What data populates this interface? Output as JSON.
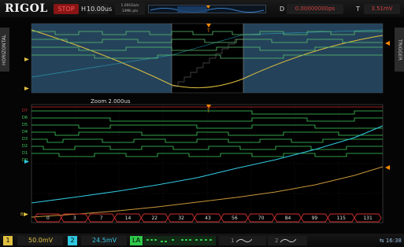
{
  "brand": "RIGOL",
  "run_state": "STOP",
  "timebase": {
    "label": "H",
    "value": "10.00us",
    "sample_rate_line1": "1.00GSa/s",
    "sample_rate_line2": "14Mk pts"
  },
  "delay": {
    "label": "D",
    "value": "0.00000000ps"
  },
  "trigger": {
    "label": "T",
    "value": "3.51mV"
  },
  "side_tabs": {
    "left": "HORIZONTAL",
    "right": "TRIGGER"
  },
  "zoom": {
    "label": "Zoom",
    "value": "2.000us"
  },
  "digital_channels": [
    "D0",
    "D1",
    "D2",
    "D3",
    "D4",
    "D5",
    "D6",
    "D7"
  ],
  "bus_values": [
    "0",
    "3",
    "7",
    "14",
    "22",
    "32",
    "43",
    "56",
    "70",
    "84",
    "99",
    "115",
    "131"
  ],
  "bottom": {
    "ch1": {
      "num": "1",
      "scale": "50.0mV"
    },
    "ch2": {
      "num": "2",
      "scale": "24.5mV"
    },
    "la": "LA",
    "math": "1",
    "ref": "2",
    "clock": "16:38"
  },
  "colors": {
    "ch1": "#e0c040",
    "ch2": "#30c8e0",
    "la": "#2ec84a",
    "bus": "#d03030",
    "trigger": "#ff8a00",
    "upper_window": "#2a4f6a"
  }
}
